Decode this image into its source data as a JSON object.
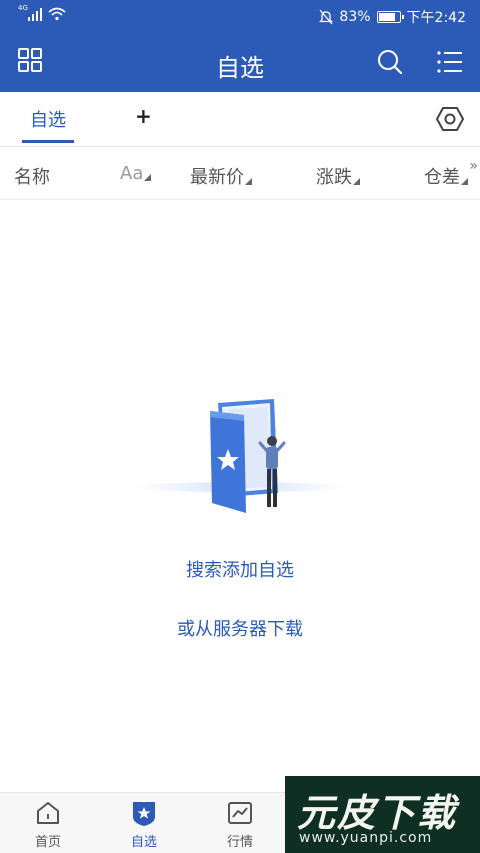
{
  "status_bar": {
    "network": "4G",
    "battery": "83%",
    "battery_level": 0.83,
    "time": "下午2:42"
  },
  "header": {
    "title": "自选",
    "icons": [
      "grid-icon",
      "search-icon",
      "list-menu-icon"
    ]
  },
  "tabs": {
    "active_label": "自选",
    "add_label": "+",
    "settings_icon": "hexagon-settings-icon"
  },
  "columns": {
    "name": "名称",
    "font_toggle": "Aa",
    "latest_price": "最新价",
    "change": "涨跌",
    "position_diff": "仓差",
    "more": "»"
  },
  "empty_state": {
    "search_add": "搜索添加自选",
    "download": "或从服务器下载"
  },
  "bottom_nav": {
    "items": [
      {
        "label": "首页",
        "icon": "home-icon"
      },
      {
        "label": "自选",
        "icon": "star-shield-icon",
        "active": true
      },
      {
        "label": "行情",
        "icon": "chart-icon"
      }
    ]
  },
  "watermark": {
    "logo": "元皮下载",
    "url": "www.yuanpi.com"
  },
  "colors": {
    "primary": "#2b5bb7",
    "watermark_bg": "#0f2f24"
  }
}
